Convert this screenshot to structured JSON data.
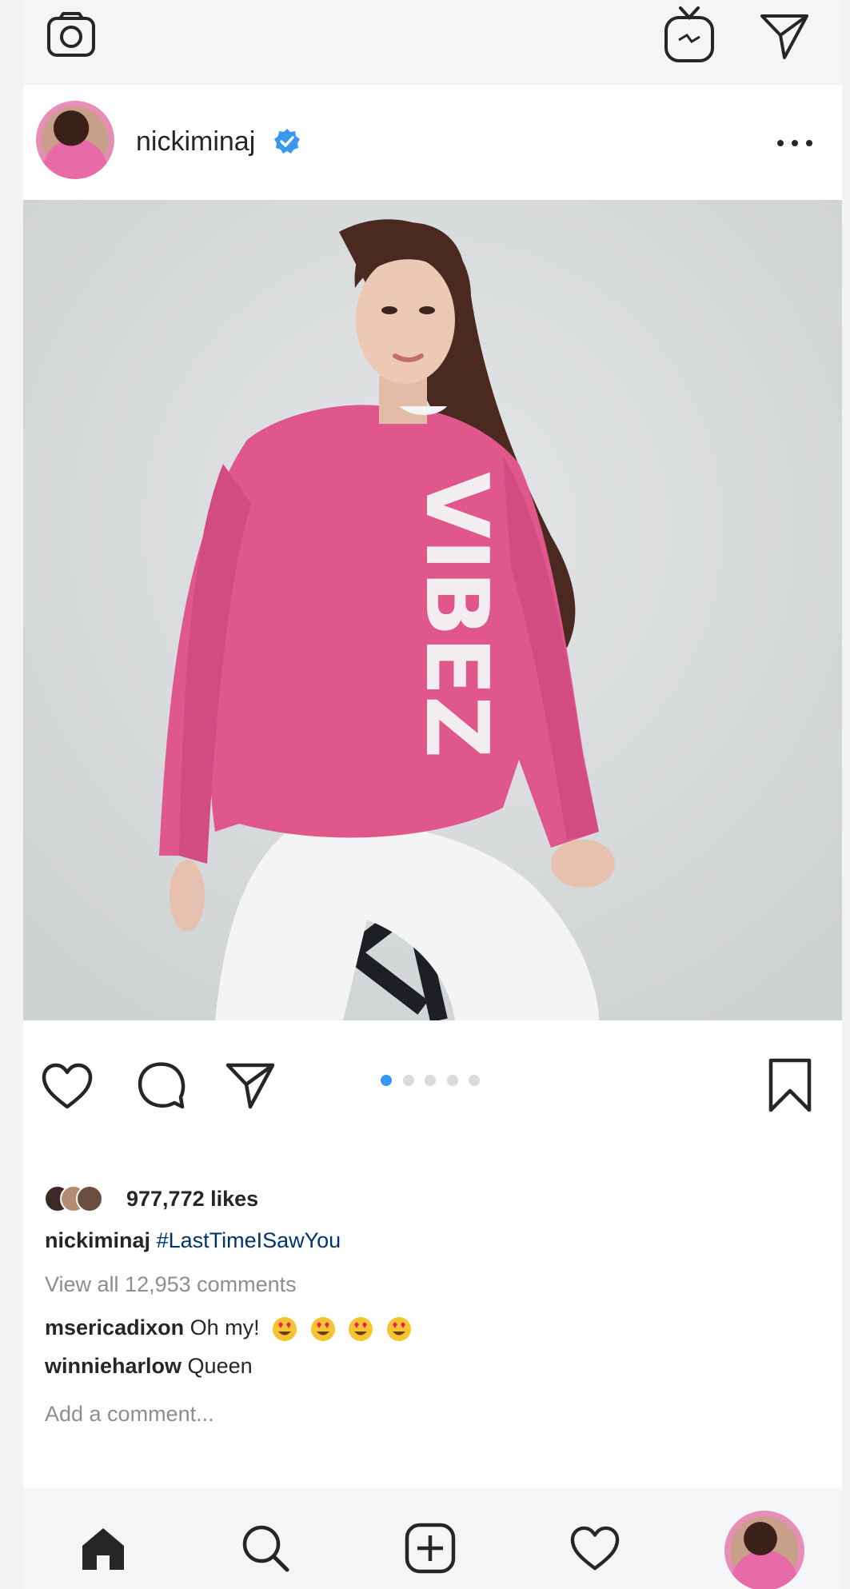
{
  "top_bar": {
    "icons": [
      "camera-icon",
      "igtv-icon",
      "direct-message-icon"
    ]
  },
  "post": {
    "username": "nickiminaj",
    "verified": true,
    "photo_text": "VIBEZ",
    "carousel": {
      "count": 5,
      "active_index": 0
    },
    "likes": "977,772 likes",
    "caption_user": "nickiminaj",
    "caption_hashtag": "#LastTimeISawYou",
    "view_comments": "View all 12,953 comments",
    "comments": [
      {
        "user": "msericadixon",
        "text": "Oh my!",
        "emoji_count": 4
      },
      {
        "user": "winnieharlow",
        "text": "Queen"
      }
    ],
    "add_comment_placeholder": "Add a comment..."
  },
  "bottom_nav": {
    "items": [
      "home-icon",
      "search-icon",
      "new-post-icon",
      "activity-icon",
      "profile-avatar"
    ]
  },
  "colors": {
    "accent": "#3897f0",
    "verified": "#3897f0",
    "hashtag": "#003569",
    "sweater": "#e0578c"
  }
}
